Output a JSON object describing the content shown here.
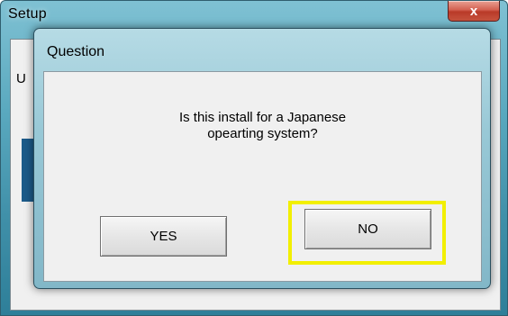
{
  "setup_window": {
    "title": "Setup",
    "close_glyph": "x",
    "partial_text": "U"
  },
  "dialog": {
    "title": "Question",
    "message_line1": "Is this install for a Japanese",
    "message_line2": "opearting system?",
    "yes_label": "YES",
    "no_label": "NO",
    "highlight_color": "#f2ef00"
  }
}
